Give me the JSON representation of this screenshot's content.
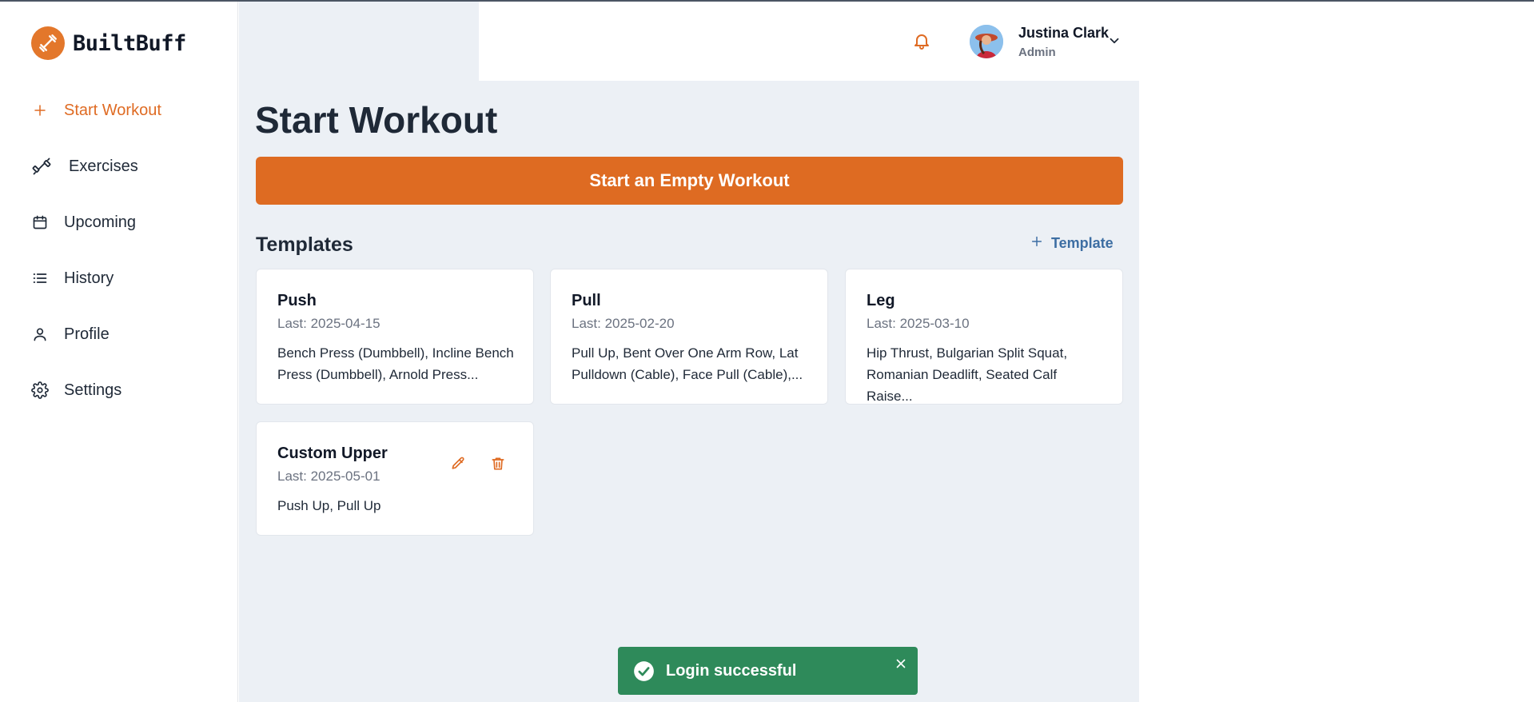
{
  "brand": {
    "name": "BuiltBuff",
    "logo_icon": "dumbbell-icon",
    "accent": "#e3772b"
  },
  "sidebar": {
    "items": [
      {
        "label": "Start Workout",
        "icon": "plus-icon",
        "active": true
      },
      {
        "label": "Exercises",
        "icon": "dumbbell-icon",
        "active": false
      },
      {
        "label": "Upcoming",
        "icon": "calendar-icon",
        "active": false
      },
      {
        "label": "History",
        "icon": "list-icon",
        "active": false
      },
      {
        "label": "Profile",
        "icon": "user-icon",
        "active": false
      },
      {
        "label": "Settings",
        "icon": "gear-icon",
        "active": false
      }
    ]
  },
  "header": {
    "notification_icon": "bell-icon",
    "user": {
      "name": "Justina Clark",
      "role": "Admin",
      "menu_icon": "chevron-down-icon"
    }
  },
  "main": {
    "title": "Start Workout",
    "start_empty_label": "Start an Empty Workout",
    "templates_heading": "Templates",
    "add_template_label": "Template",
    "templates": [
      {
        "name": "Push",
        "last": "Last: 2025-04-15",
        "exercises": "Bench Press (Dumbbell), Incline Bench Press (Dumbbell), Arnold Press..."
      },
      {
        "name": "Pull",
        "last": "Last: 2025-02-20",
        "exercises": "Pull Up, Bent Over One Arm Row, Lat Pulldown (Cable), Face Pull (Cable),..."
      },
      {
        "name": "Leg",
        "last": "Last: 2025-03-10",
        "exercises": "Hip Thrust, Bulgarian Split Squat, Romanian Deadlift, Seated Calf Raise..."
      },
      {
        "name": "Custom Upper",
        "last": "Last: 2025-05-01",
        "exercises": "Push Up, Pull Up",
        "editable": true
      }
    ]
  },
  "toast": {
    "message": "Login successful",
    "icon": "check-circle-icon",
    "color": "#2e8a5a"
  },
  "colors": {
    "accent": "#df6b23",
    "link": "#3d6ea3",
    "background": "#ecf0f5"
  }
}
